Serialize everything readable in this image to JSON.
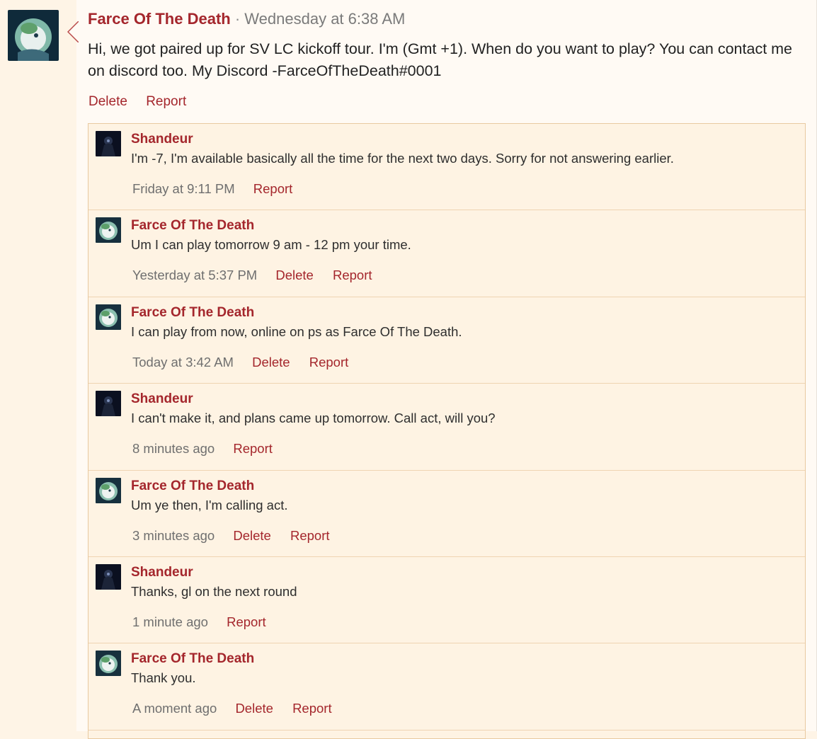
{
  "status": {
    "author": "Farce Of The Death",
    "separator": "·",
    "time": "Wednesday at 6:38 AM",
    "message": "Hi, we got paired up for SV LC kickoff tour. I'm (Gmt +1). When do you want to play? You can contact me on discord too. My Discord -FarceOfTheDeath#0001",
    "actions": {
      "delete": "Delete",
      "report": "Report"
    }
  },
  "replies": [
    {
      "author": "Shandeur",
      "avatar": "shandeur",
      "text": "I'm -7, I'm available basically all the time for the next two days. Sorry for not answering earlier.",
      "time": "Friday at 9:11 PM",
      "delete": "",
      "report": "Report"
    },
    {
      "author": "Farce Of The Death",
      "avatar": "farce",
      "text": "Um I can play tomorrow 9 am - 12 pm your time.",
      "time": "Yesterday at 5:37 PM",
      "delete": "Delete",
      "report": "Report"
    },
    {
      "author": "Farce Of The Death",
      "avatar": "farce",
      "text": "I can play from now, online on ps as Farce Of The Death.",
      "time": "Today at 3:42 AM",
      "delete": "Delete",
      "report": "Report"
    },
    {
      "author": "Shandeur",
      "avatar": "shandeur",
      "text": "I can't make it, and plans came up tomorrow. Call act, will you?",
      "time": "8 minutes ago",
      "delete": "",
      "report": "Report"
    },
    {
      "author": "Farce Of The Death",
      "avatar": "farce",
      "text": "Um ye then, I'm calling act.",
      "time": "3 minutes ago",
      "delete": "Delete",
      "report": "Report"
    },
    {
      "author": "Shandeur",
      "avatar": "shandeur",
      "text": "Thanks, gl on the next round",
      "time": "1 minute ago",
      "delete": "",
      "report": "Report"
    },
    {
      "author": "Farce Of The Death",
      "avatar": "farce",
      "text": "Thank you.",
      "time": "A moment ago",
      "delete": "Delete",
      "report": "Report"
    }
  ],
  "colors": {
    "accent": "#a4262c",
    "background": "#fef4e6",
    "card": "#fffaf4",
    "replies_bg": "#fef3e3"
  }
}
